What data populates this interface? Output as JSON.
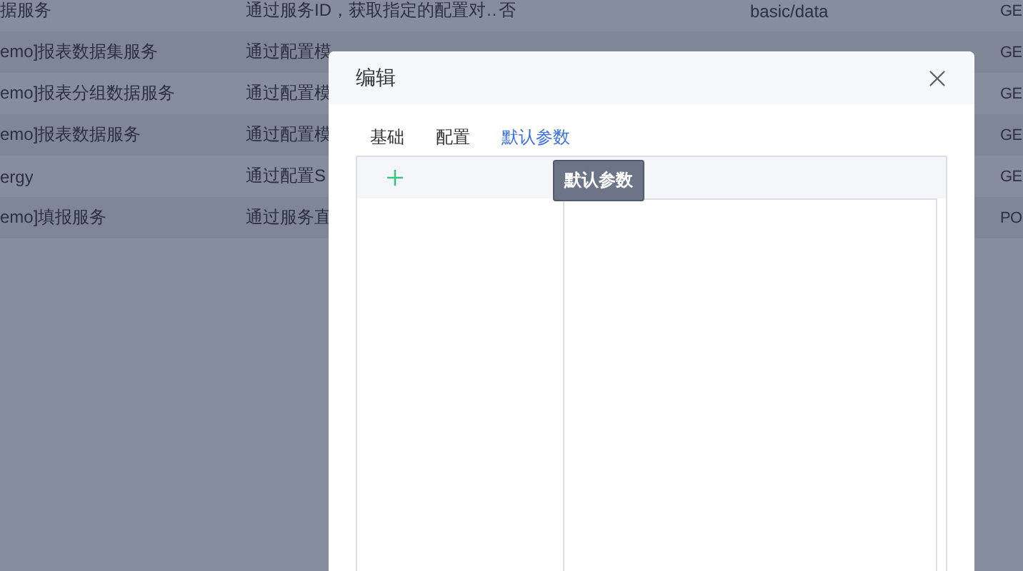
{
  "table": {
    "rows": [
      {
        "column_1": "据服务",
        "column_2": "通过服务ID，获取指定的配置对…",
        "column_3": "否",
        "column_4": "basic/data",
        "column_5": "GE"
      },
      {
        "column_1": "emo]报表数据集服务",
        "column_2": "通过配置模",
        "column_5": "GE"
      },
      {
        "column_1": "emo]报表分组数据服务",
        "column_2": "通过配置模",
        "column_5": "GE"
      },
      {
        "column_1": "emo]报表数据服务",
        "column_2": "通过配置模",
        "column_5": "GE"
      },
      {
        "column_1": "ergy",
        "column_2": "通过配置S",
        "column_5": "GE"
      },
      {
        "column_1": "emo]填报服务",
        "column_2": "通过服务直",
        "column_5": "PO"
      }
    ]
  },
  "dialog": {
    "title": "编辑",
    "tabs": [
      {
        "label": "基础",
        "selected": false
      },
      {
        "label": "配置",
        "selected": false
      },
      {
        "label": "默认参数",
        "selected": true
      }
    ],
    "tooltip": "默认参数"
  }
}
